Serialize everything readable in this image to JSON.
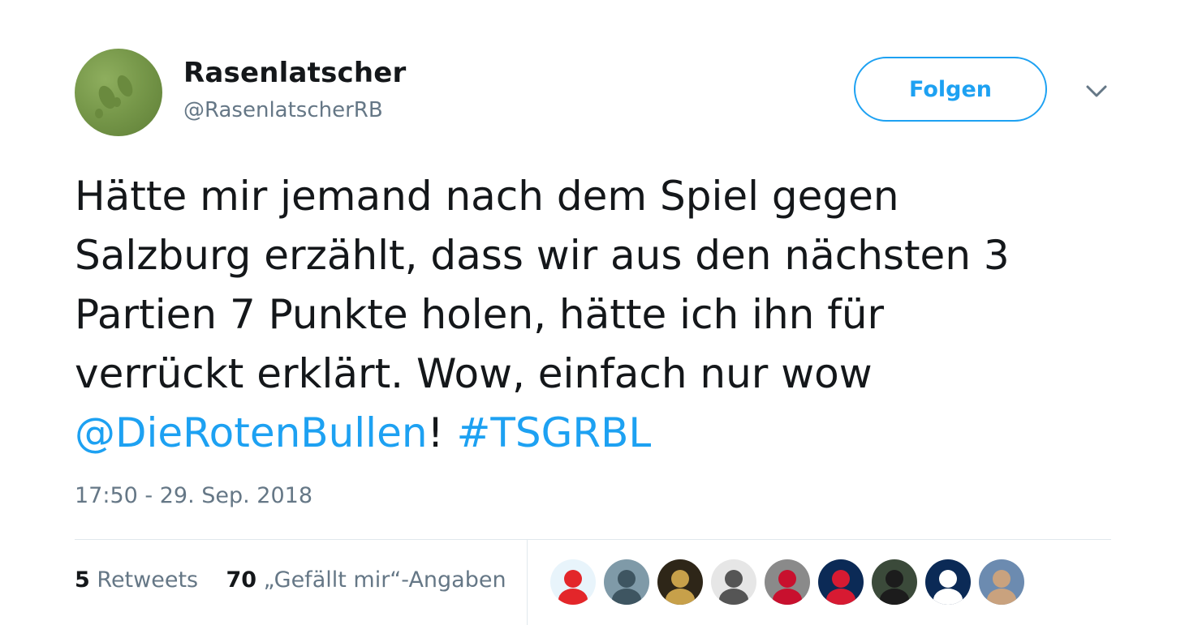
{
  "user": {
    "name": "Rasenlatscher",
    "handle": "@RasenlatscherRB",
    "avatar_icon": "footprints-on-grass-avatar"
  },
  "follow_button": {
    "label": "Folgen",
    "color": "#1da1f2"
  },
  "menu": {
    "icon": "chevron-down-icon"
  },
  "tweet": {
    "lines": [
      "Hätte mir jemand nach dem Spiel gegen",
      "Salzburg erzählt, dass wir aus den nächsten 3",
      "Partien 7 Punkte holen, hätte ich ihn für",
      "verrückt erklärt. Wow, einfach nur wow"
    ],
    "mention": "@DieRotenBullen",
    "after_mention": "! ",
    "hashtag": "#TSGRBL",
    "link_color": "#1da1f2"
  },
  "timestamp": "17:50 - 29. Sep. 2018",
  "stats": {
    "retweets_count": "5",
    "retweets_label": "Retweets",
    "likes_count": "70",
    "likes_label": "„Gefällt mir“-Angaben"
  },
  "likers": [
    {
      "icon": "red-mascot-avatar",
      "bg": "#e8f4fb",
      "fg": "#e3262a"
    },
    {
      "icon": "sky-landscape-avatar",
      "bg": "#7f9aa8",
      "fg": "#3e5561"
    },
    {
      "icon": "dark-photo-avatar",
      "bg": "#2e2618",
      "fg": "#c7a04a"
    },
    {
      "icon": "sketch-avatar",
      "bg": "#e6e6e6",
      "fg": "#555555"
    },
    {
      "icon": "grey-badge-avatar",
      "bg": "#8a8a8a",
      "fg": "#c8102e"
    },
    {
      "icon": "navy-badge-avatar",
      "bg": "#0b2a56",
      "fg": "#d71a32"
    },
    {
      "icon": "person-photo-avatar",
      "bg": "#3b4a3a",
      "fg": "#1c1c1c"
    },
    {
      "icon": "white-crest-avatar",
      "bg": "#0b2a56",
      "fg": "#ffffff"
    },
    {
      "icon": "couple-photo-avatar",
      "bg": "#6c8bb0",
      "fg": "#c9a27e"
    }
  ]
}
